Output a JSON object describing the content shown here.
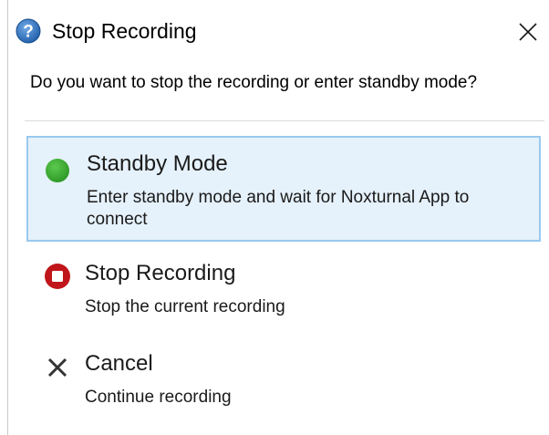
{
  "dialog": {
    "title": "Stop Recording",
    "question": "Do you want to stop the recording or enter standby mode?",
    "close_icon": "close-icon",
    "help_icon": "help-icon"
  },
  "options": [
    {
      "title": "Standby Mode",
      "description": "Enter standby mode and wait for Noxturnal App to connect",
      "icon": "green-dot-icon",
      "selected": true,
      "color": "#3fa535"
    },
    {
      "title": "Stop Recording",
      "description": "Stop the current recording",
      "icon": "stop-record-icon",
      "selected": false,
      "color": "#c0161b"
    },
    {
      "title": "Cancel",
      "description": "Continue recording",
      "icon": "cancel-x-icon",
      "selected": false,
      "color": "#333333"
    }
  ],
  "colors": {
    "selected_background": "#e5f1fb",
    "selected_border": "#99c9ef",
    "help_icon_blue": "#2f6fb8"
  }
}
